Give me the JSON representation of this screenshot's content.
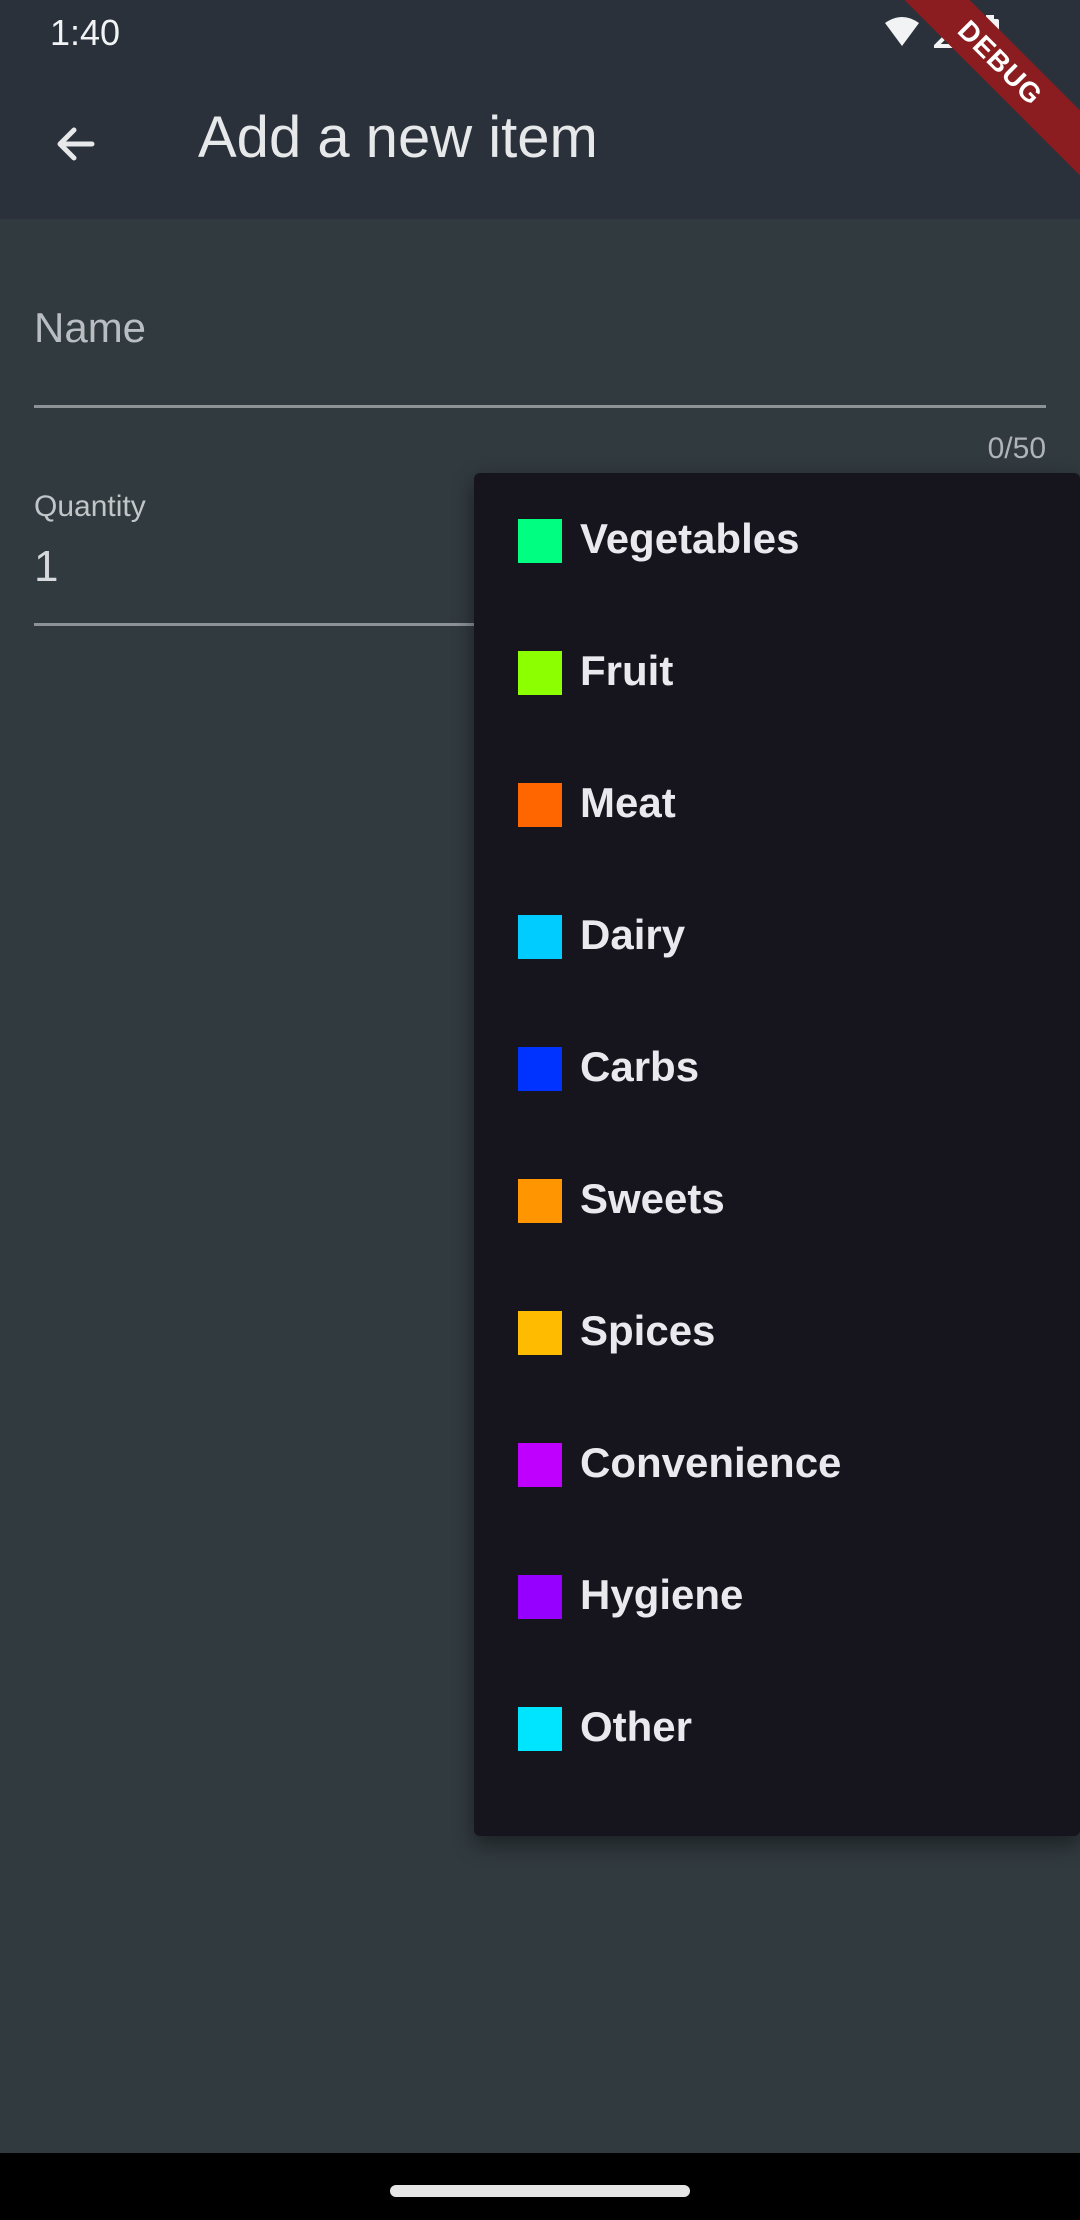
{
  "status_bar": {
    "time": "1:40"
  },
  "debug_banner": "DEBUG",
  "app_bar": {
    "title": "Add a new item"
  },
  "form": {
    "name_placeholder": "Name",
    "name_counter": "0/50",
    "quantity_label": "Quantity",
    "quantity_value": "1"
  },
  "category_menu": {
    "items": [
      {
        "label": "Vegetables",
        "color": "#00ff80"
      },
      {
        "label": "Fruit",
        "color": "#8cff00"
      },
      {
        "label": "Meat",
        "color": "#ff6600"
      },
      {
        "label": "Dairy",
        "color": "#00ccff"
      },
      {
        "label": "Carbs",
        "color": "#0033ff"
      },
      {
        "label": "Sweets",
        "color": "#ff9500"
      },
      {
        "label": "Spices",
        "color": "#ffbb00"
      },
      {
        "label": "Convenience",
        "color": "#bf00ff"
      },
      {
        "label": "Hygiene",
        "color": "#9500ff"
      },
      {
        "label": "Other",
        "color": "#00e5ff"
      }
    ]
  }
}
